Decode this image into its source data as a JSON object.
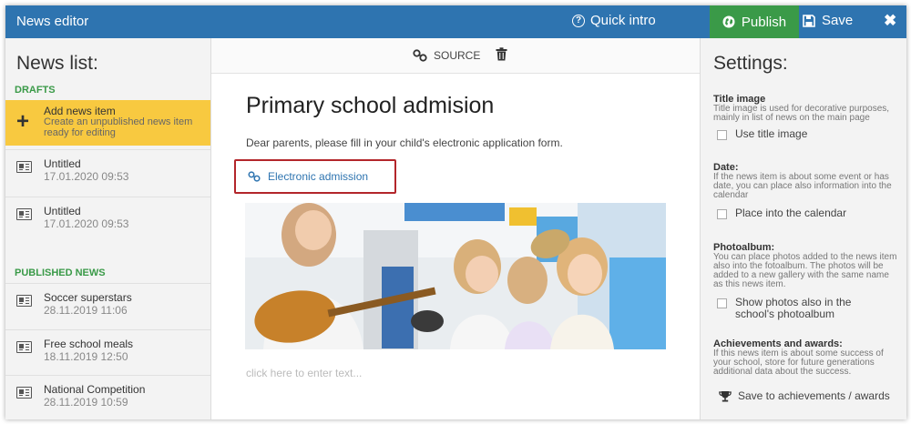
{
  "topbar": {
    "title": "News editor",
    "quick_intro": "Quick intro",
    "publish": "Publish",
    "save": "Save",
    "close": "✖"
  },
  "left": {
    "title": "News list:",
    "drafts_label": "DRAFTS",
    "add_item": {
      "title": "Add news item",
      "desc": "Create an unpublished news item ready for editing"
    },
    "drafts": [
      {
        "title": "Untitled",
        "date": "17.01.2020 09:53"
      },
      {
        "title": "Untitled",
        "date": "17.01.2020 09:53"
      }
    ],
    "published_label": "PUBLISHED NEWS",
    "published": [
      {
        "title": "Soccer superstars",
        "date": "28.11.2019 11:06"
      },
      {
        "title": "Free school meals",
        "date": "18.11.2019 12:50"
      },
      {
        "title": "National Competition",
        "date": "28.11.2019 10:59"
      }
    ]
  },
  "center": {
    "source": "SOURCE",
    "title": "Primary school admision",
    "text": "Dear parents, please fill in your child's electronic application form.",
    "link": "Electronic admission",
    "placeholder": "click here to enter text..."
  },
  "settings": {
    "title": "Settings:",
    "title_image": {
      "head": "Title image",
      "desc": "Title image is used for decorative purposes, mainly in list of news on the main page",
      "check": "Use title image"
    },
    "date": {
      "head": "Date:",
      "desc": "If the news item is about some event or has date, you can place also information into the calendar",
      "check": "Place into the calendar"
    },
    "photoalbum": {
      "head": "Photoalbum:",
      "desc": "You can place photos added to the news item also into the fotoalbum. The photos will be added to a new gallery with the same name as this news item.",
      "check": "Show photos also in the school's photoalbum"
    },
    "achievements": {
      "head": "Achievements and awards:",
      "desc": "If this news item is about some success of your school, store for future generations additional data about the success.",
      "action": "Save to achievements / awards"
    }
  },
  "colors": {
    "topbar": "#2e74b0",
    "publish": "#3a9a48",
    "add_item": "#f8c940",
    "highlight": "#b3262b"
  }
}
